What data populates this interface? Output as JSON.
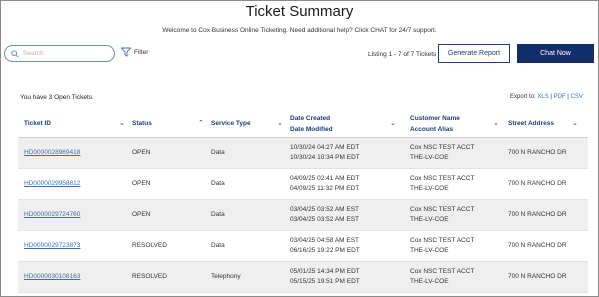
{
  "page": {
    "title": "Ticket Summary",
    "welcome": "Welcome to Cox Business Online Ticketing. Need additional help? Click CHAT for 24/7 support."
  },
  "toolbar": {
    "search_placeholder": "Search",
    "filter_label": "Filter",
    "listing": "Listing 1 - 7 of 7 Tickets",
    "report_label": "Generate Report",
    "chat_label": "Chat Now"
  },
  "summary": {
    "open_count": "You have 3 Open Tickets.",
    "export_label": "Export to:",
    "export_xls": "XLS",
    "export_pdf": "PDF",
    "export_csv": "CSV",
    "sep": "|"
  },
  "table": {
    "headers": {
      "ticket_id": "Ticket ID",
      "status": "Status",
      "service_type": "Service Type",
      "date_created": "Date Created",
      "date_modified": "Date Modified",
      "customer_name": "Customer Name",
      "account_alias": "Account Alias",
      "street_address": "Street Address"
    },
    "rows": [
      {
        "id": "HD0000028969418",
        "status": "OPEN",
        "service": "Data",
        "created": "10/30/24 04:27 AM EDT",
        "modified": "10/30/24 10:34 PM EDT",
        "customer": "Cox NSC TEST ACCT",
        "alias": "THE-LV-COE",
        "address": "700 N RANCHO DR"
      },
      {
        "id": "HD0000029958812",
        "status": "OPEN",
        "service": "Data",
        "created": "04/09/25 02:41 AM EDT",
        "modified": "04/09/25 11:32 PM EDT",
        "customer": "Cox NSC TEST ACCT",
        "alias": "THE-LV-COE",
        "address": "700 N RANCHO DR"
      },
      {
        "id": "HD0000029724760",
        "status": "OPEN",
        "service": "Data",
        "created": "03/04/25 03:52 AM EST",
        "modified": "03/04/25 03:52 AM EST",
        "customer": "Cox NSC TEST ACCT",
        "alias": "THE-LV-COE",
        "address": "700 N RANCHO DR"
      },
      {
        "id": "HD0000029723873",
        "status": "RESOLVED",
        "service": "Data",
        "created": "03/04/25 04:58 AM EST",
        "modified": "06/16/25 19:22 PM EDT",
        "customer": "Cox NSC TEST ACCT",
        "alias": "THE-LV-COE",
        "address": "700 N RANCHO DR"
      },
      {
        "id": "HD0000030108163",
        "status": "RESOLVED",
        "service": "Telephony",
        "created": "05/01/25 14:34 PM EDT",
        "modified": "05/15/25 19:51 PM EDT",
        "customer": "Cox NSC TEST ACCT",
        "alias": "THE-LV-COE",
        "address": "700 N RANCHO DR"
      }
    ]
  },
  "colors": {
    "brand_navy": "#132d6b",
    "link_blue": "#3a6fb3",
    "row_alt": "#efefef"
  }
}
